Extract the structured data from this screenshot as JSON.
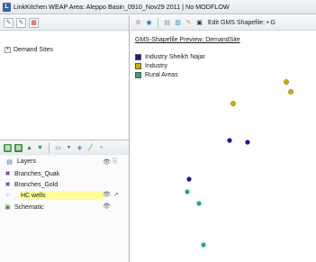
{
  "window": {
    "app_icon_letter": "L",
    "title": "LinkKitchen   WEAP Area: Aleppo Basin_0910_Nov29 2011 | No MODFLOW"
  },
  "tree": {
    "expander": "+",
    "root_label": "Demand Sites"
  },
  "layers": {
    "header_label": "Layers",
    "items": [
      {
        "label": "Branches_Quak",
        "selected": false
      },
      {
        "label": "Branches_Gold",
        "selected": false
      },
      {
        "label": "HC wells",
        "selected": true
      },
      {
        "label": "Schematic",
        "selected": false
      }
    ]
  },
  "right_toolbar": {
    "edit_label": "Edit GMS Shapefile: • G"
  },
  "preview": {
    "title": "GMS-Shapefile Preview: DemandSite",
    "legend": [
      {
        "label": "Industry Sheikh Najar",
        "color": "#1a1a8c"
      },
      {
        "label": "Industry",
        "color": "#c8b400"
      },
      {
        "label": "Rural Areas",
        "color": "#2aa878"
      }
    ]
  },
  "colors": {
    "selection_highlight": "#ffff99",
    "industry_sheikh_najar": "#1a1a8c",
    "industry": "#c8b400",
    "rural_areas": "#2aa878"
  }
}
